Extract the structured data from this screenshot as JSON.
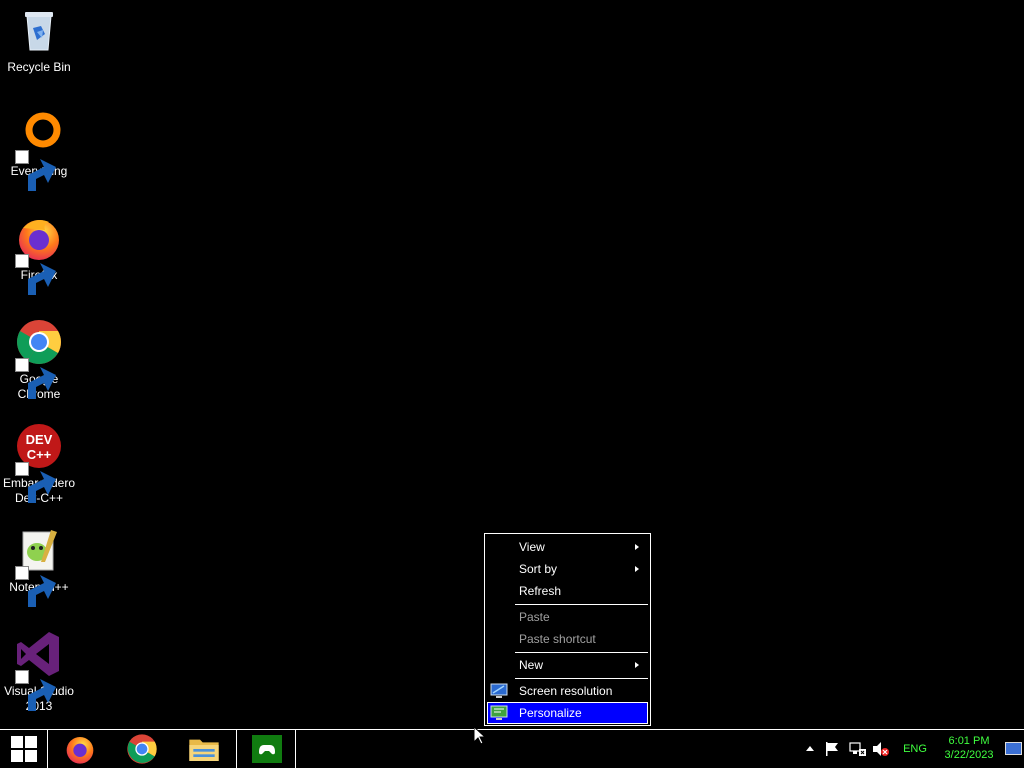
{
  "desktop": {
    "icons": [
      {
        "label": "Recycle Bin",
        "icon": "recycle-bin-icon"
      },
      {
        "label": "Everything",
        "icon": "everything-icon"
      },
      {
        "label": "Firefox",
        "icon": "firefox-icon"
      },
      {
        "label": "Google Chrome",
        "icon": "chrome-icon"
      },
      {
        "label": "Embarcadero Dev-C++",
        "icon": "devcpp-icon",
        "logo_text": "DEV C++"
      },
      {
        "label": "Notepad++",
        "icon": "notepadpp-icon"
      },
      {
        "label": "Visual Studio 2013",
        "icon": "visual-studio-icon"
      }
    ]
  },
  "context_menu": {
    "items": [
      {
        "label": "View",
        "submenu": true
      },
      {
        "label": "Sort by",
        "submenu": true
      },
      {
        "label": "Refresh"
      },
      {
        "label": "Paste",
        "disabled": true
      },
      {
        "label": "Paste shortcut",
        "disabled": true
      },
      {
        "label": "New",
        "submenu": true
      },
      {
        "label": "Screen resolution",
        "icon": "monitor-icon"
      },
      {
        "label": "Personalize",
        "icon": "monitor-icon",
        "highlighted": true
      }
    ],
    "highlight_color": "#0000ff"
  },
  "taskbar": {
    "apps": [
      "start-button",
      "firefox-icon",
      "chrome-icon",
      "file-explorer-icon",
      "xbox-icon"
    ],
    "tray": {
      "language": "ENG",
      "time": "6:01 PM",
      "date": "3/22/2023",
      "text_color": "#3fff3f"
    }
  }
}
